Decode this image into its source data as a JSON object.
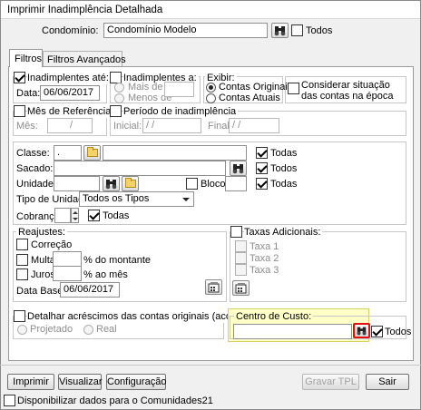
{
  "window": {
    "title": "Imprimir Inadimplência Detalhada"
  },
  "condominio": {
    "label": "Condomínio:",
    "value": "Condomínio Modelo",
    "todos_label": "Todos"
  },
  "tabs": [
    {
      "label": "Filtros"
    },
    {
      "label": "Filtros Avançados"
    }
  ],
  "inadimplentes_ate": {
    "label": "Inadimplentes até:",
    "data_label": "Data:",
    "data_value": "06/06/2017"
  },
  "inadimplentes_a": {
    "label": "Inadimplentes a:",
    "mais_de": "Mais de",
    "menos_de": "Menos de"
  },
  "exibir": {
    "label": "Exibir:",
    "options": [
      "Contas Originais",
      "Contas Atuais"
    ]
  },
  "considerar": {
    "label_line1": "Considerar situação",
    "label_line2": "das contas na época"
  },
  "mes_referencia": {
    "label": "Mês de Referência:",
    "mes_label": "Mês:",
    "mes_value": "/"
  },
  "periodo": {
    "label": "Período de inadimplência",
    "inicial_label": "Inicial:",
    "inicial_value": "/  /",
    "final_label": "Final:",
    "final_value": "/  /"
  },
  "classe": {
    "label": "Classe:",
    "code": ".",
    "todas": "Todas"
  },
  "sacado": {
    "label": "Sacado:",
    "todos": "Todos"
  },
  "unidade": {
    "label": "Unidade:",
    "bloco_label": "Bloco:",
    "todas": "Todas"
  },
  "tipo_unidade": {
    "label": "Tipo de Unidade:",
    "selected": "Todos os Tipos"
  },
  "cobranca": {
    "label": "Cobrança:",
    "todas": "Todas"
  },
  "reajustes": {
    "label": "Reajustes:",
    "correcao": "Correção",
    "multa": "Multa",
    "multa_suffix": "% do montante",
    "juros": "Juros",
    "juros_suffix": "% ao mês",
    "data_base_label": "Data Base:",
    "data_base_value": "06/06/2017"
  },
  "taxas": {
    "label": "Taxas Adicionais:",
    "items": [
      "Taxa 1",
      "Taxa 2",
      "Taxa 3"
    ]
  },
  "detalhar": {
    "label": "Detalhar acréscimos das contas originais (acordos):",
    "projetado": "Projetado",
    "real": "Real"
  },
  "centro_custo": {
    "label": "Centro de Custo:",
    "todos": "Todos"
  },
  "buttons": {
    "imprimir": "Imprimir",
    "visualizar": "Visualizar",
    "configuracao": "Configuração",
    "gravar_tpl": "Gravar TPL",
    "sair": "Sair"
  },
  "footer": {
    "disponibilizar": "Disponibilizar dados para o Comunidades21"
  },
  "colors": {
    "highlight_bg": "#ffffc8",
    "highlight_border": "#d9d16a",
    "red_border": "#e01010"
  }
}
